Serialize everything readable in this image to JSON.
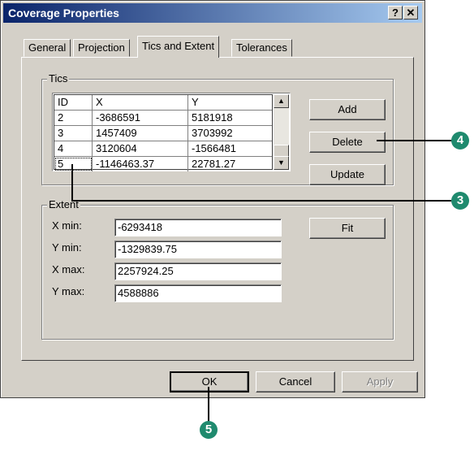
{
  "window": {
    "title": "Coverage Properties",
    "help_label": "?",
    "close_label": "✕"
  },
  "tabs": [
    {
      "label": "General"
    },
    {
      "label": "Projection"
    },
    {
      "label": "Tics and Extent",
      "active": true
    },
    {
      "label": "Tolerances"
    }
  ],
  "tics": {
    "group_label": "Tics",
    "columns": [
      "ID",
      "X",
      "Y"
    ],
    "rows": [
      {
        "id": "2",
        "x": "-3686591",
        "y": "5181918"
      },
      {
        "id": "3",
        "x": "1457409",
        "y": "3703992"
      },
      {
        "id": "4",
        "x": "3120604",
        "y": "-1566481"
      },
      {
        "id": "5",
        "x": "-1146463.37",
        "y": "22781.27"
      }
    ],
    "buttons": {
      "add": "Add",
      "delete": "Delete",
      "update": "Update"
    }
  },
  "extent": {
    "group_label": "Extent",
    "fields": [
      {
        "label": "X min:",
        "value": "-6293418"
      },
      {
        "label": "Y min:",
        "value": "-1329839.75"
      },
      {
        "label": "X max:",
        "value": "2257924.25"
      },
      {
        "label": "Y max:",
        "value": "4588886"
      }
    ],
    "fit_label": "Fit"
  },
  "footer": {
    "ok_label": "OK",
    "cancel_label": "Cancel",
    "apply_label": "Apply"
  },
  "callouts": [
    {
      "number": "4"
    },
    {
      "number": "3"
    },
    {
      "number": "5"
    }
  ],
  "colors": {
    "dialog_bg": "#d4d0c8",
    "titlebar_start": "#0a246a",
    "titlebar_end": "#a6caf0",
    "callout": "#1f8a6e"
  }
}
